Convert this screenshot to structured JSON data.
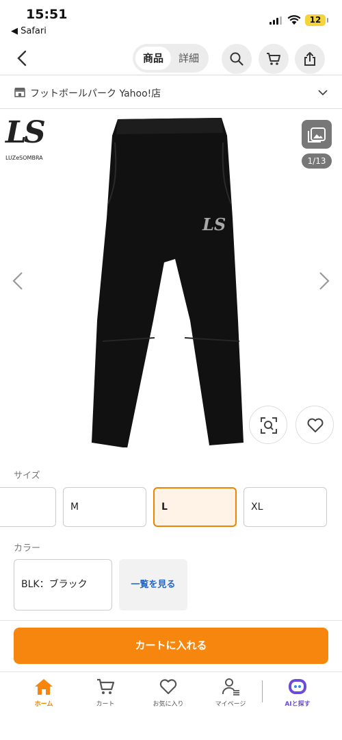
{
  "status_bar": {
    "time": "15:51",
    "back_app": "◀ Safari",
    "battery": "12"
  },
  "nav": {
    "tab_product": "商品",
    "tab_details": "詳細"
  },
  "store": {
    "name": "フットボールパーク Yahoo!店"
  },
  "gallery": {
    "counter": "1/13",
    "brand_logo": "LS",
    "brand_name": "LUZeSOMBRA"
  },
  "size": {
    "label": "サイズ",
    "options": [
      "M",
      "L",
      "XL"
    ],
    "selected": "L"
  },
  "color": {
    "label": "カラー",
    "selected": "BLK：ブラック",
    "view_all": "一覧を見る"
  },
  "cart_button": "カートに入れる",
  "tabbar": {
    "home": "ホーム",
    "cart": "カート",
    "favorites": "お気に入り",
    "mypage": "マイページ",
    "ai": "AIと探す"
  },
  "colors": {
    "accent": "#f7860e",
    "selected_bg": "#fff2e6",
    "link": "#2468c7",
    "ai": "#6a4cd8"
  }
}
